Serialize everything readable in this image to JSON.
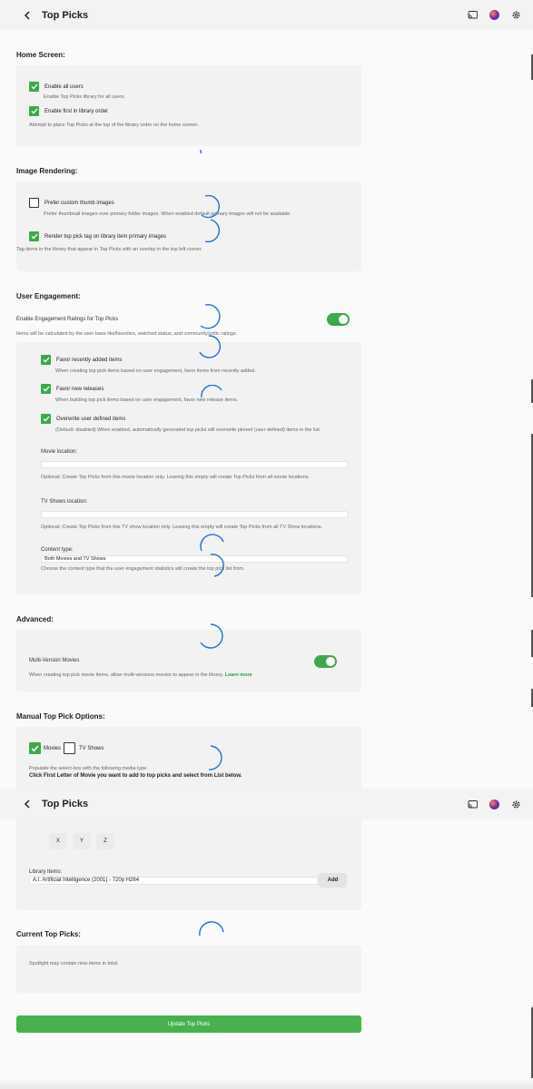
{
  "header": {
    "title": "Top Picks"
  },
  "home_screen": {
    "title": "Home Screen:",
    "enable_all_users": {
      "label": "Enable all users",
      "desc": "Enable Top Picks library for all users.",
      "checked": true
    },
    "enable_first": {
      "label": "Enable first in library order",
      "checked": true
    },
    "note": "Attempt to place Top Picks at the top of the library order on the home screen."
  },
  "image_rendering": {
    "title": "Image Rendering:",
    "prefer_custom": {
      "label": "Prefer custom thumb images",
      "desc": "Prefer thumbnail images over primary folder images. When enabled default primary images will not be available.",
      "checked": false
    },
    "render_tag": {
      "label": "Render top pick tag on library item primary images",
      "checked": true
    },
    "note": "Tag items in the library that appear in Top Picks with an overlay in the top left corner."
  },
  "user_engagement": {
    "title": "User Engagement:",
    "toggle_label": "Enable Engagement Ratings for Top Picks",
    "toggle_on": true,
    "toggle_desc": "Items will be calculated by the user base like/favorites, watched status, and community/critic ratings.",
    "favor_recent": {
      "label": "Favor recently added items",
      "desc": "When creating top pick items based on user engagement, favor items from recently added.",
      "checked": true
    },
    "favor_new": {
      "label": "Favor new releases",
      "desc": "When building top pick items based on user engagement, favor new release items.",
      "checked": true
    },
    "overwrite": {
      "label": "Overwrite user defined items",
      "desc": "(Default: disabled) When enabled, automatically generated top picks will overwrite pinned (user defined) items in the list.",
      "checked": true
    },
    "movie_location": {
      "label": "Movie location:",
      "value": "",
      "desc": "Optional: Create Top Picks from this movie location only. Leaving this empty will create Top Picks from all movie locations."
    },
    "tv_location": {
      "label": "TV Shows location:",
      "value": "",
      "desc": "Optional: Create Top Picks from this TV show location only. Leaving this empty will create Top Picks from all TV Show locations."
    },
    "content_type": {
      "label": "Content type:",
      "value": "Both Movies and TV Shows",
      "desc": "Choose the content type that the user engagement statistics will create the top pick list from."
    }
  },
  "advanced": {
    "title": "Advanced:",
    "multi_version": {
      "label": "Multi-Version Movies",
      "desc": "When creating top pick movie items, allow multi-versions movies to appear in the library.",
      "learn_more": "Learn more",
      "on": true
    }
  },
  "manual": {
    "title": "Manual Top Pick Options:",
    "movies_label": "Movies",
    "movies_checked": true,
    "tv_label": "TV Shows",
    "tv_checked": false,
    "populate_desc": "Populate the select-box with the following media type.",
    "instruction": "Click First Letter of Movie you want to add to top picks and select from List below.",
    "letters": [
      "X",
      "Y",
      "Z"
    ],
    "library_label": "Library Items:",
    "library_value": "A.I. Artificial Intelligence (2001) - 720p H264",
    "add_label": "Add"
  },
  "current": {
    "title": "Current Top Picks:",
    "note": "Spotlight may contain nine items in total."
  },
  "update_label": "Update Top Picks",
  "colors": {
    "accent": "#3daa4a",
    "spinner": "#1e6fd9"
  }
}
